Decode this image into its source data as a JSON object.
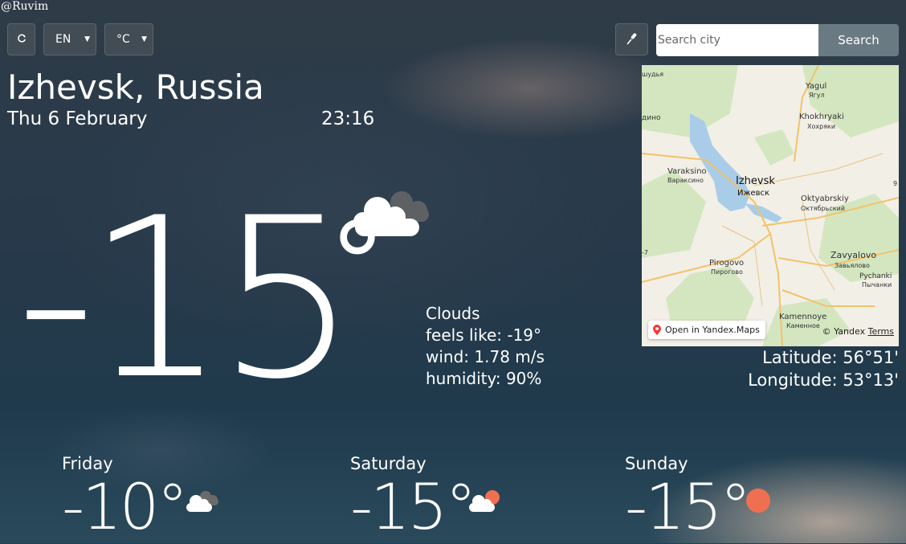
{
  "watermark": "@Ruvim",
  "controls": {
    "language": "EN",
    "unit": "°C",
    "refresh_icon": "refresh-icon",
    "mic_icon": "microphone-icon"
  },
  "search": {
    "placeholder": "Search city",
    "button": "Search"
  },
  "location": {
    "city": "Izhevsk, Russia",
    "date": "Thu 6 February",
    "time": "23:16"
  },
  "current": {
    "temperature": "-15",
    "degree": "°",
    "icon": "cloudy-night-icon",
    "description": "Clouds",
    "feels_like": "feels like: -19°",
    "wind": "wind: 1.78 m/s",
    "humidity": "humidity: 90%"
  },
  "map": {
    "labels": [
      "Yagul",
      "Ягул",
      "Khokhryaki",
      "Хохряки",
      "Varaksino",
      "Вараксино",
      "Izhevsk",
      "Ижевск",
      "Oktyabrskiy",
      "Октябрьский",
      "Pirogovo",
      "Пирогово",
      "Zavyalovo",
      "Завьялово",
      "Pychanki",
      "Пычанки",
      "Kamennoye",
      "Каменное",
      "дино",
      "шудья",
      "-7",
      "9"
    ],
    "open_link": "Open in Yandex.Maps",
    "copyright": "© Yandex",
    "terms": "Terms",
    "colors": {
      "land": "#f2efe6",
      "forest": "#d3e6c0",
      "water": "#a9cde8",
      "road": "#f3c26a"
    }
  },
  "coords": {
    "latitude": "Latitude: 56°51'",
    "longitude": "Longitude: 53°13'"
  },
  "forecast": [
    {
      "day": "Friday",
      "temp": "-10°",
      "icon": "clouds-icon"
    },
    {
      "day": "Saturday",
      "temp": "-15°",
      "icon": "sun-behind-cloud-icon"
    },
    {
      "day": "Sunday",
      "temp": "-15°",
      "icon": "sun-icon"
    }
  ],
  "colors": {
    "sun": "#ef7050",
    "cloud": "#ffffff",
    "dark_cloud": "#6a6a6a"
  }
}
